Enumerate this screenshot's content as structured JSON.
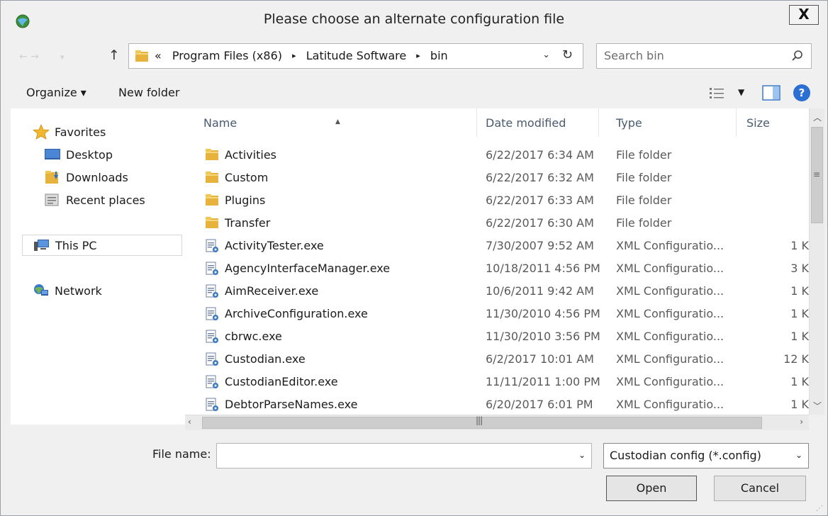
{
  "window": {
    "title": "Please choose an alternate configuration file",
    "close_label": "X"
  },
  "address": {
    "overflow": "«",
    "segments": [
      "Program Files (x86)",
      "Latitude Software",
      "bin"
    ],
    "separator": "▸"
  },
  "search": {
    "placeholder": "Search bin"
  },
  "toolbar": {
    "organize_label": "Organize ▾",
    "new_folder_label": "New folder",
    "help_label": "?"
  },
  "nav": {
    "favorites": "Favorites",
    "desktop": "Desktop",
    "downloads": "Downloads",
    "recent": "Recent places",
    "this_pc": "This PC",
    "network": "Network"
  },
  "columns": {
    "name": "Name",
    "date": "Date modified",
    "type": "Type",
    "size": "Size"
  },
  "files": [
    {
      "name": "Activities",
      "date": "6/22/2017 6:34 AM",
      "type": "File folder",
      "size": "",
      "kind": "folder"
    },
    {
      "name": "Custom",
      "date": "6/22/2017 6:32 AM",
      "type": "File folder",
      "size": "",
      "kind": "folder"
    },
    {
      "name": "Plugins",
      "date": "6/22/2017 6:33 AM",
      "type": "File folder",
      "size": "",
      "kind": "folder"
    },
    {
      "name": "Transfer",
      "date": "6/22/2017 6:30 AM",
      "type": "File folder",
      "size": "",
      "kind": "folder"
    },
    {
      "name": "ActivityTester.exe",
      "date": "7/30/2007 9:52 AM",
      "type": "XML Configuratio...",
      "size": "1 K",
      "kind": "config"
    },
    {
      "name": "AgencyInterfaceManager.exe",
      "date": "10/18/2011 4:56 PM",
      "type": "XML Configuratio...",
      "size": "3 K",
      "kind": "config"
    },
    {
      "name": "AimReceiver.exe",
      "date": "10/6/2011 9:42 AM",
      "type": "XML Configuratio...",
      "size": "1 K",
      "kind": "config"
    },
    {
      "name": "ArchiveConfiguration.exe",
      "date": "11/30/2010 4:56 PM",
      "type": "XML Configuratio...",
      "size": "1 K",
      "kind": "config"
    },
    {
      "name": "cbrwc.exe",
      "date": "11/30/2010 3:56 PM",
      "type": "XML Configuratio...",
      "size": "1 K",
      "kind": "config"
    },
    {
      "name": "Custodian.exe",
      "date": "6/2/2017 10:01 AM",
      "type": "XML Configuratio...",
      "size": "12 K",
      "kind": "config"
    },
    {
      "name": "CustodianEditor.exe",
      "date": "11/11/2011 1:00 PM",
      "type": "XML Configuratio...",
      "size": "1 K",
      "kind": "config"
    },
    {
      "name": "DebtorParseNames.exe",
      "date": "6/20/2017 6:01 PM",
      "type": "XML Configuratio...",
      "size": "1 K",
      "kind": "config"
    }
  ],
  "footer": {
    "file_name_label": "File name:",
    "file_name_value": "",
    "filter_value": "Custodian config (*.config)",
    "open_label": "Open",
    "cancel_label": "Cancel"
  },
  "colors": {
    "folder": "#e8b33c",
    "accent": "#2a6fd1",
    "header_text": "#4a5a70"
  }
}
